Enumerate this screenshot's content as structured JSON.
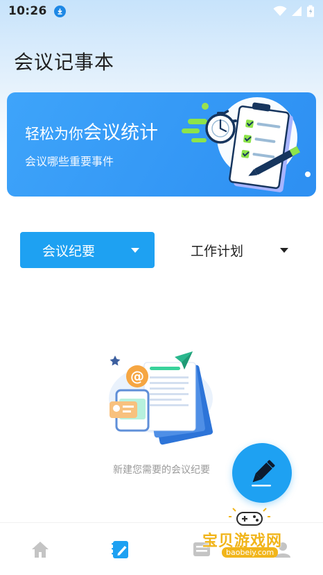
{
  "status_bar": {
    "time": "10:26",
    "icons": [
      "download-icon",
      "wifi-icon",
      "signal-icon",
      "battery-icon"
    ]
  },
  "app": {
    "title": "会议记事本"
  },
  "banner": {
    "headline_prefix": "轻松为你",
    "headline_emphasis": "会议统计",
    "subtitle": "会议哪些重要事件"
  },
  "tabs": [
    {
      "label": "会议纪要",
      "selected": true
    },
    {
      "label": "工作计划",
      "selected": false
    }
  ],
  "empty_state": {
    "text": "新建您需要的会议纪要"
  },
  "fab": {
    "icon": "pencil-icon"
  },
  "bottom_nav": {
    "items": [
      {
        "icon": "home-icon",
        "active": false
      },
      {
        "icon": "edit-note-icon",
        "active": true
      },
      {
        "icon": "list-icon",
        "active": false
      },
      {
        "icon": "profile-icon",
        "active": false
      }
    ]
  },
  "watermark": {
    "title": "宝贝游戏网",
    "url": "baobeiy.com"
  },
  "colors": {
    "accent": "#1ea1f2",
    "banner": "#3ea4fa",
    "nav_inactive": "#c4c4c4"
  }
}
